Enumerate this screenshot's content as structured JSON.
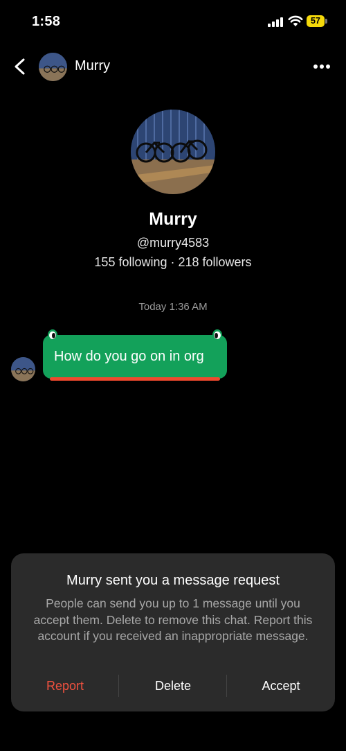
{
  "status_bar": {
    "time": "1:58",
    "battery": "57"
  },
  "header": {
    "name": "Murry"
  },
  "profile": {
    "name": "Murry",
    "handle": "@murry4583",
    "stats": "155 following · 218 followers"
  },
  "conversation": {
    "timestamp": "Today 1:36 AM",
    "messages": [
      {
        "text": "How do you go on in org"
      }
    ]
  },
  "request": {
    "title": "Murry sent you a message request",
    "body": "People can send you up to 1 message until you accept them. Delete to remove this chat. Report this account if you received an inappropriate message.",
    "actions": {
      "report": "Report",
      "delete": "Delete",
      "accept": "Accept"
    }
  },
  "colors": {
    "bubble": "#13a15a",
    "report": "#f0513f",
    "battery": "#f5d90a",
    "sheet": "#2b2b2b"
  }
}
